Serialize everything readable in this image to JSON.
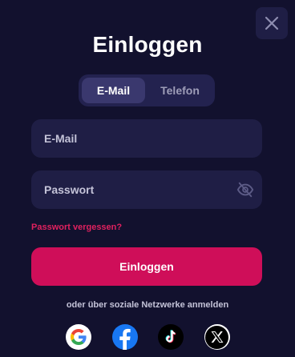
{
  "modal": {
    "title": "Einloggen"
  },
  "tabs": [
    {
      "label": "E-Mail",
      "active": true
    },
    {
      "label": "Telefon",
      "active": false
    }
  ],
  "form": {
    "email_placeholder": "E-Mail",
    "email_value": "",
    "password_placeholder": "Passwort",
    "password_value": "",
    "forgot_label": "Passwort vergessen?",
    "submit_label": "Einloggen"
  },
  "social": {
    "text": "oder über soziale Netzwerke anmelden",
    "providers": [
      "google-icon",
      "facebook-icon",
      "tiktok-icon",
      "x-icon"
    ]
  },
  "colors": {
    "background": "#12112e",
    "surface": "#1f1e45",
    "accent": "#cf0e59",
    "link": "#e0215f"
  }
}
